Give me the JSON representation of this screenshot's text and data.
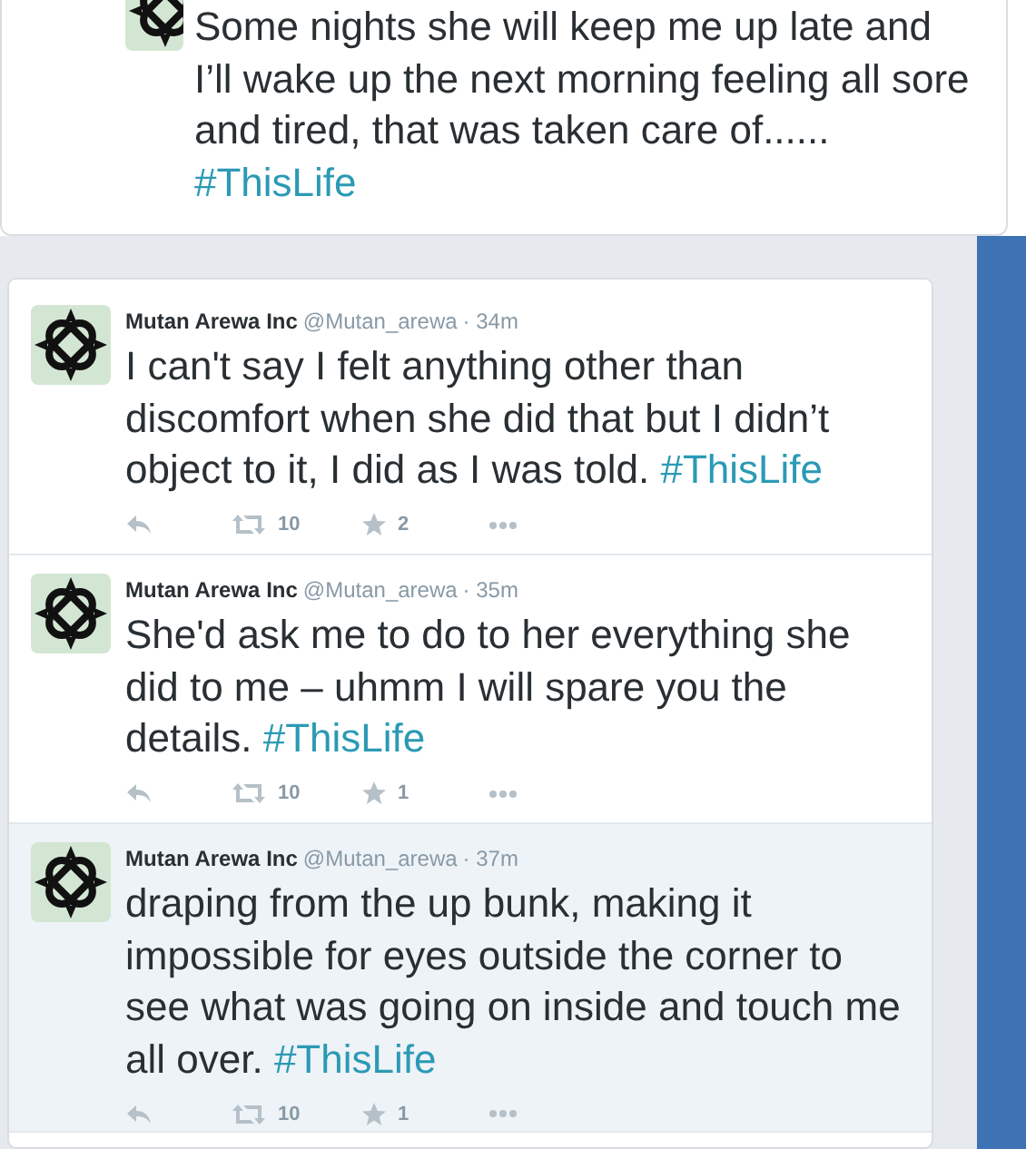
{
  "top_tweet": {
    "text": "Some nights she will keep me up late and I’ll wake up the next morning feeling all sore and tired, that was taken care of......",
    "hashtag": "#ThisLife"
  },
  "tweets": [
    {
      "name": "Mutan Arewa Inc",
      "handle": "@Mutan_arewa",
      "time": "· 34m",
      "text": "I can't say I felt anything other than discomfort when she did that but I didn’t object to it, I did as I was told.",
      "hashtag": "#ThisLife",
      "retweets": "10",
      "favorites": "2",
      "highlighted": false
    },
    {
      "name": "Mutan Arewa Inc",
      "handle": "@Mutan_arewa",
      "time": "· 35m",
      "text": "She'd ask me to do to her everything she did to me – uhmm I will spare you the details.",
      "hashtag": "#ThisLife",
      "retweets": "10",
      "favorites": "1",
      "highlighted": false
    },
    {
      "name": "Mutan Arewa Inc",
      "handle": "@Mutan_arewa",
      "time": "· 37m",
      "text": "draping from the up bunk, making it impossible for eyes outside the corner to see what was going on inside and touch me all over.",
      "hashtag": "#ThisLife",
      "retweets": "10",
      "favorites": "1",
      "highlighted": true
    }
  ]
}
